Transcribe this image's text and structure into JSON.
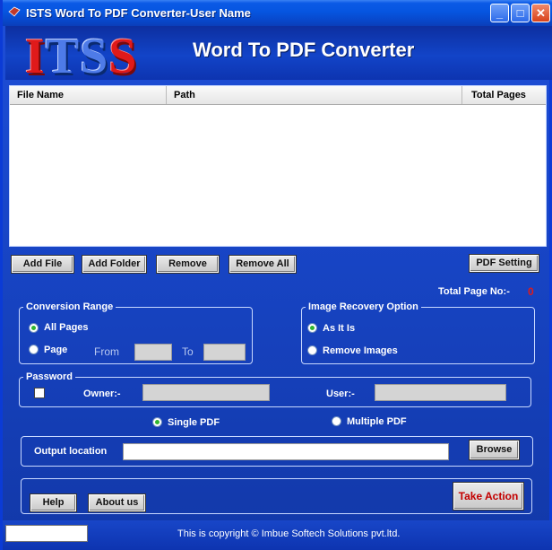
{
  "window": {
    "title": "ISTS Word To PDF Converter-User Name",
    "controls": {
      "minimize": "_",
      "maximize": "□",
      "close": "✕"
    }
  },
  "header": {
    "logo": {
      "i": "I",
      "ts": "TS",
      "s": "S"
    },
    "heading": "Word To PDF Converter"
  },
  "file_table": {
    "columns": [
      "File Name",
      "Path",
      "Total Pages"
    ],
    "rows": []
  },
  "buttons": {
    "add_file": "Add File",
    "add_folder": "Add Folder",
    "remove": "Remove",
    "remove_all": "Remove All",
    "pdf_setting": "PDF Setting",
    "browse": "Browse",
    "help": "Help",
    "about": "About us",
    "take_action": "Take Action"
  },
  "total_pages": {
    "label": "Total Page No:-",
    "value": "0"
  },
  "conversion_range": {
    "legend": "Conversion Range",
    "all_pages": "All Pages",
    "page": "Page",
    "from_label": "From",
    "to_label": "To",
    "from_value": "",
    "to_value": ""
  },
  "image_recovery": {
    "legend": "Image Recovery Option",
    "as_it_is": "As It Is",
    "remove_images": "Remove Images"
  },
  "password": {
    "legend": "Password",
    "owner_label": "Owner:-",
    "user_label": "User:-",
    "owner_value": "",
    "user_value": ""
  },
  "output_mode": {
    "single": "Single PDF",
    "multiple": "Multiple PDF"
  },
  "output": {
    "label": "Output location",
    "value": ""
  },
  "status": {
    "copyright": "This is copyright © Imbue Softech Solutions pvt.ltd."
  },
  "colors": {
    "title_bar": "#0655e0",
    "background": "#1846c8",
    "accent_red": "#e01a1a",
    "take_action_text": "#c40000"
  }
}
